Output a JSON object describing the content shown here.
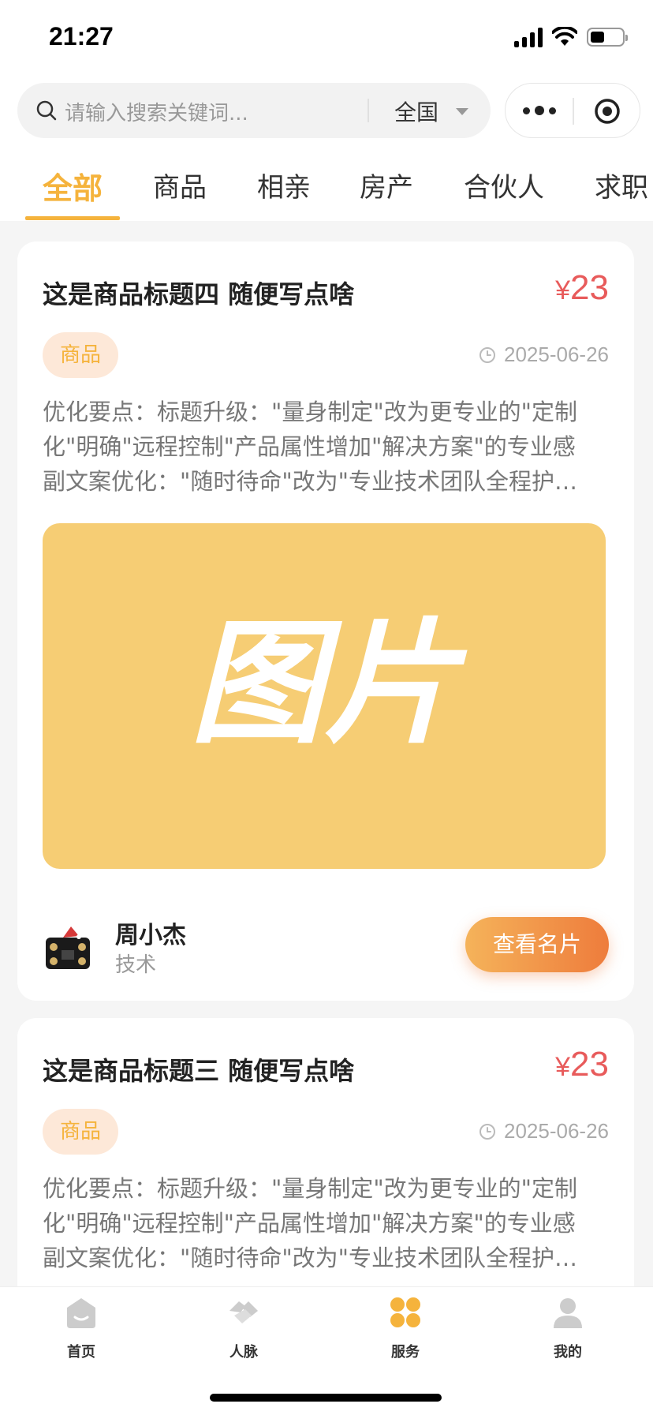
{
  "status_bar": {
    "time": "21:27",
    "battery_level": 0.45
  },
  "header": {
    "search_placeholder": "请输入搜索关键词...",
    "region": "全国"
  },
  "tabs": [
    {
      "label": "全部",
      "active": true
    },
    {
      "label": "商品"
    },
    {
      "label": "相亲"
    },
    {
      "label": "房产"
    },
    {
      "label": "合伙人"
    },
    {
      "label": "求职"
    }
  ],
  "posts": [
    {
      "title": "这是商品标题四 随便写点啥",
      "currency": "¥",
      "price": "23",
      "tag": "商品",
      "date": "2025-06-26",
      "desc_lines": [
        "优化要点：标题升级：\"量身制定\"改为更专业的\"定制",
        "化\"明确\"远程控制\"产品属性增加\"解决方案\"的专业感",
        "副文案优化：\"随时待命\"改为\"专业技术团队全程护…"
      ],
      "image_text": "图片",
      "author": {
        "name": "周小杰",
        "role": "技术"
      },
      "button_label": "查看名片"
    },
    {
      "title": "这是商品标题三 随便写点啥",
      "currency": "¥",
      "price": "23",
      "tag": "商品",
      "date": "2025-06-26",
      "desc_lines": [
        "优化要点：标题升级：\"量身制定\"改为更专业的\"定制",
        "化\"明确\"远程控制\"产品属性增加\"解决方案\"的专业感",
        "副文案优化：\"随时待命\"改为\"专业技术团队全程护…"
      ]
    }
  ],
  "tabbar": [
    {
      "label": "首页",
      "icon": "home-icon",
      "color": "#cccccc"
    },
    {
      "label": "人脉",
      "icon": "handshake-icon",
      "color": "#cccccc"
    },
    {
      "label": "服务",
      "icon": "grid-icon",
      "color": "#f5b33c"
    },
    {
      "label": "我的",
      "icon": "user-icon",
      "color": "#cccccc"
    }
  ],
  "colors": {
    "accent": "#f5b33c",
    "price": "#e85b5b",
    "image_bg": "#f6cd74"
  }
}
